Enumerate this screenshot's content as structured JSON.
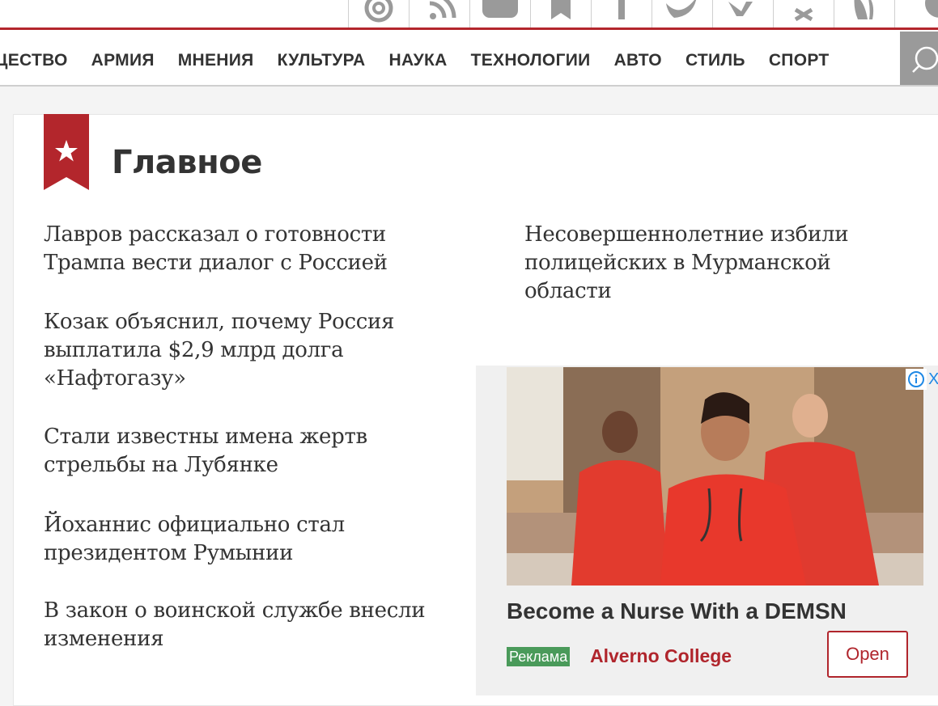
{
  "social": {
    "icons": [
      "email-icon",
      "rss-icon",
      "youtube-icon",
      "bookmark-icon",
      "facebook-icon",
      "twitter-icon",
      "vk-icon",
      "odnoklassniki-icon",
      "flame-icon",
      "social-network-icon"
    ]
  },
  "nav": {
    "items": [
      "ЩЕСТВО",
      "АРМИЯ",
      "МНЕНИЯ",
      "КУЛЬТУРА",
      "НАУКА",
      "ТЕХНОЛОГИИ",
      "АВТО",
      "СТИЛЬ",
      "СПОРТ"
    ],
    "search_icon": "search-icon"
  },
  "section": {
    "title": "Главное",
    "icon": "star-icon"
  },
  "headlines": {
    "left": [
      "Лавров рассказал о готовности Трампа вести диалог с Россией",
      "Козак объяснил, почему Россия выплатила $2,9 млрд долга «Нафтогазу»",
      "Стали известны имена жертв стрельбы на Лубянке",
      "Йоханнис официально стал президентом Румынии",
      "В закон о воинской службе внесли изменения"
    ],
    "right": [
      "Несовершеннолетние избили полицейских в Мурманской области"
    ]
  },
  "ad": {
    "title": "Become a Nurse With a DEMSN",
    "badge": "Реклама",
    "advertiser": "Alverno College",
    "button": "Open",
    "close": "X"
  },
  "colors": {
    "brand_red": "#b3262c",
    "ad_badge_green": "#4a9a5a"
  }
}
